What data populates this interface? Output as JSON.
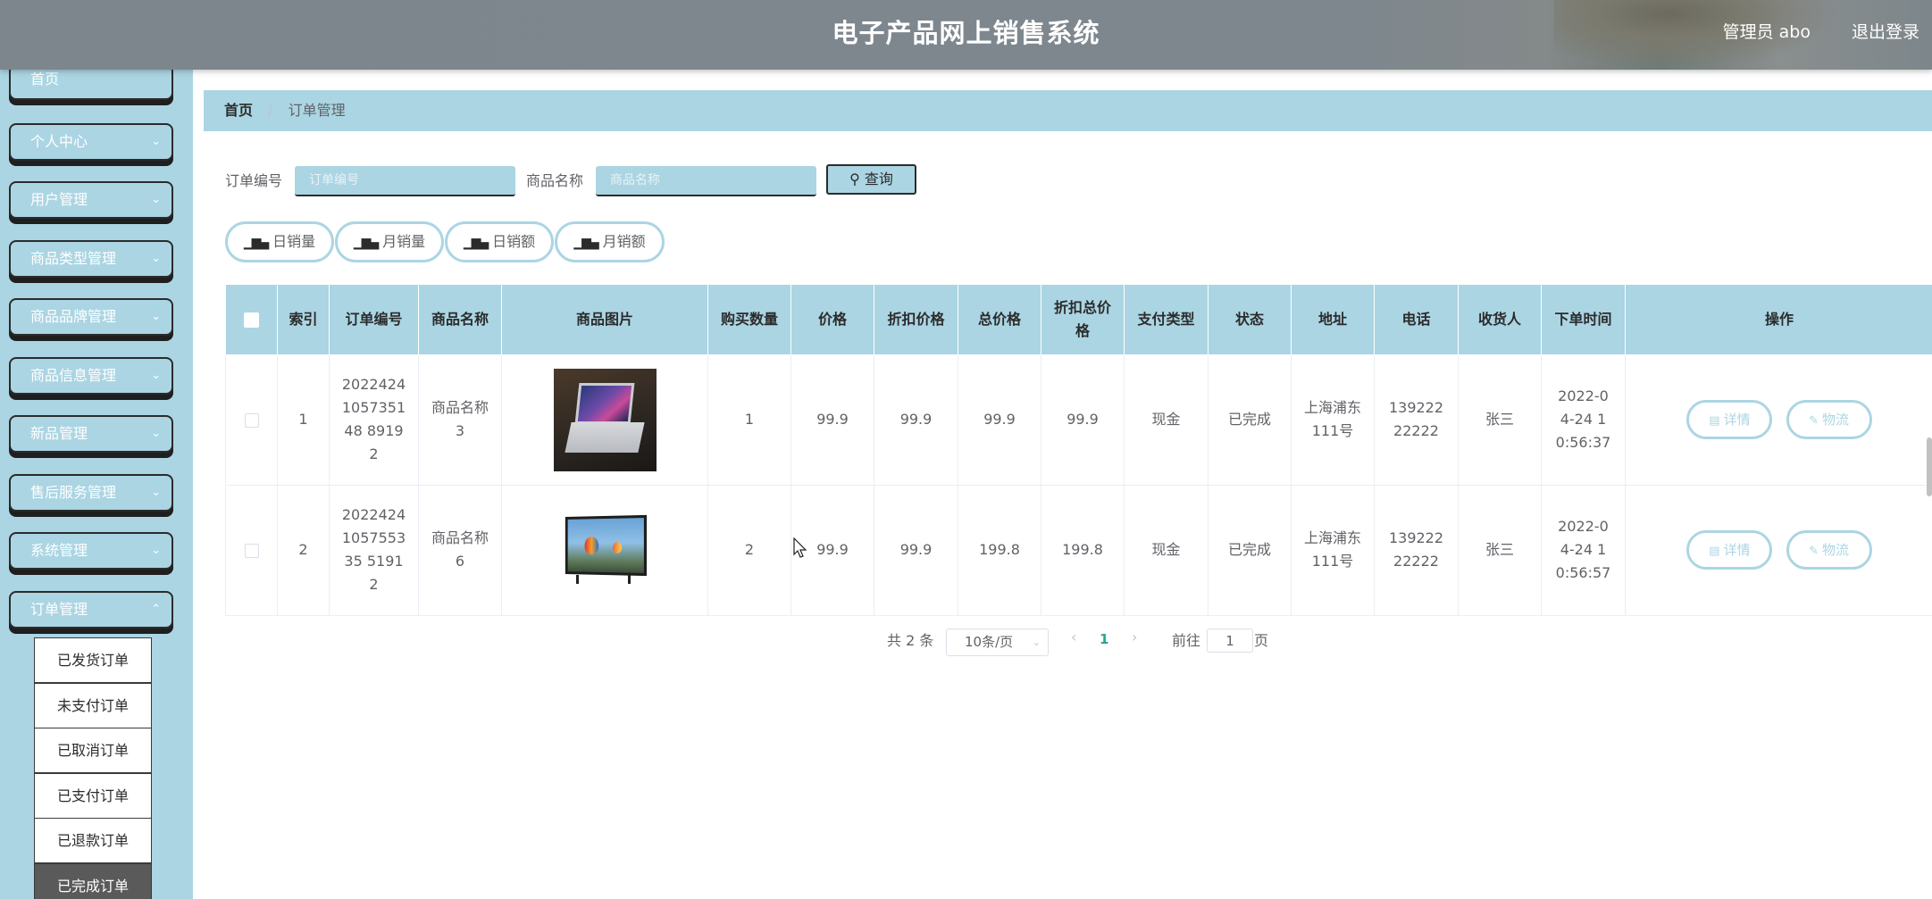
{
  "header": {
    "title": "电子产品网上销售系统",
    "user": "管理员 abo",
    "logout": "退出登录"
  },
  "sidebar": {
    "home": "首页",
    "items": [
      {
        "label": "个人中心"
      },
      {
        "label": "用户管理"
      },
      {
        "label": "商品类型管理"
      },
      {
        "label": "商品品牌管理"
      },
      {
        "label": "商品信息管理"
      },
      {
        "label": "新品管理"
      },
      {
        "label": "售后服务管理"
      },
      {
        "label": "系统管理"
      },
      {
        "label": "订单管理"
      }
    ],
    "submenu": [
      {
        "label": "已发货订单"
      },
      {
        "label": "未支付订单"
      },
      {
        "label": "已取消订单"
      },
      {
        "label": "已支付订单"
      },
      {
        "label": "已退款订单"
      },
      {
        "label": "已完成订单"
      }
    ]
  },
  "breadcrumb": {
    "home": "首页",
    "sep": "/",
    "current": "订单管理"
  },
  "search": {
    "order_no_label": "订单编号",
    "order_no_placeholder": "订单编号",
    "product_name_label": "商品名称",
    "product_name_placeholder": "商品名称",
    "button": "查询"
  },
  "stats": [
    "日销量",
    "月销量",
    "日销额",
    "月销额"
  ],
  "table": {
    "headers": [
      "索引",
      "订单编号",
      "商品名称",
      "商品图片",
      "购买数量",
      "价格",
      "折扣价格",
      "总价格",
      "折扣总价格",
      "支付类型",
      "状态",
      "地址",
      "电话",
      "收货人",
      "下单时间",
      "操作"
    ],
    "rows": [
      {
        "index": "1",
        "order_no": "2022424105735148 89192",
        "product": "商品名称3",
        "image": "laptop",
        "qty": "1",
        "price": "99.9",
        "discount_price": "99.9",
        "total": "99.9",
        "discount_total": "99.9",
        "pay_type": "现金",
        "status": "已完成",
        "address": "上海浦东111号",
        "phone": "13922222222",
        "receiver": "张三",
        "time": "2022-04-24 10:56:37"
      },
      {
        "index": "2",
        "order_no": "2022424105755335 51912",
        "product": "商品名称6",
        "image": "tv",
        "qty": "2",
        "price": "99.9",
        "discount_price": "99.9",
        "total": "199.8",
        "discount_total": "199.8",
        "pay_type": "现金",
        "status": "已完成",
        "address": "上海浦东111号",
        "phone": "13922222222",
        "receiver": "张三",
        "time": "2022-04-24 10:56:57"
      }
    ],
    "actions": {
      "detail": "详情",
      "logistics": "物流"
    }
  },
  "pagination": {
    "total": "共 2 条",
    "page_size": "10条/页",
    "current_page": "1",
    "goto_prefix": "前往",
    "goto_value": "1",
    "goto_suffix": "页"
  },
  "colors": {
    "accent": "#abd5e3",
    "header": "#7d868d",
    "active_page": "#2ba58e"
  }
}
